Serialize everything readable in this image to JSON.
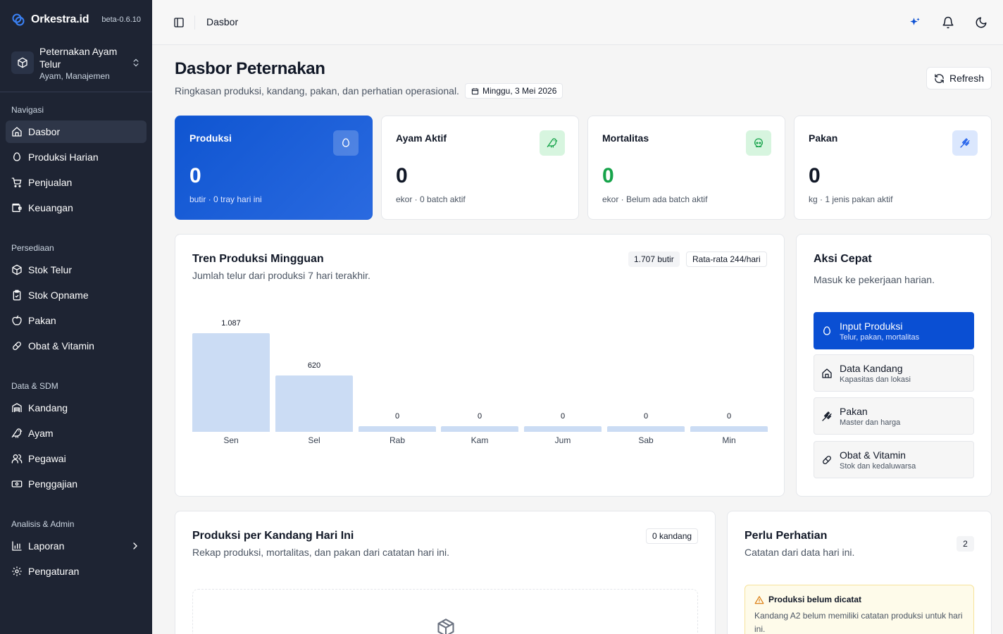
{
  "brand": {
    "name": "Orkestra.id",
    "version": "beta-0.6.10"
  },
  "org": {
    "name": "Peternakan Ayam Telur",
    "meta": "Ayam, Manajemen"
  },
  "sidebar": {
    "groups": [
      {
        "label": "Navigasi",
        "items": [
          "Dasbor",
          "Produksi Harian",
          "Penjualan",
          "Keuangan"
        ]
      },
      {
        "label": "Persediaan",
        "items": [
          "Stok Telur",
          "Stok Opname",
          "Pakan",
          "Obat & Vitamin"
        ]
      },
      {
        "label": "Data & SDM",
        "items": [
          "Kandang",
          "Ayam",
          "Pegawai",
          "Penggajian"
        ]
      },
      {
        "label": "Analisis & Admin",
        "items": [
          "Laporan",
          "Pengaturan"
        ]
      }
    ]
  },
  "header": {
    "breadcrumb": "Dasbor"
  },
  "page": {
    "title": "Dasbor Peternakan",
    "subtitle": "Ringkasan produksi, kandang, pakan, dan perhatian operasional.",
    "date": "Minggu, 3 Mei 2026",
    "refresh": "Refresh"
  },
  "stats": [
    {
      "label": "Produksi",
      "value": "0",
      "sub": "butir · 0 tray hari ini"
    },
    {
      "label": "Ayam Aktif",
      "value": "0",
      "sub": "ekor · 0 batch aktif"
    },
    {
      "label": "Mortalitas",
      "value": "0",
      "sub": "ekor · Belum ada batch aktif"
    },
    {
      "label": "Pakan",
      "value": "0",
      "sub": "kg · 1 jenis pakan aktif"
    }
  ],
  "trend": {
    "title": "Tren Produksi Mingguan",
    "subtitle": "Jumlah telur dari produksi 7 hari terakhir.",
    "total": "1.707 butir",
    "average": "Rata-rata 244/hari"
  },
  "chart_data": {
    "type": "bar",
    "categories": [
      "Sen",
      "Sel",
      "Rab",
      "Kam",
      "Jum",
      "Sab",
      "Min"
    ],
    "values": [
      1087,
      620,
      0,
      0,
      0,
      0,
      0
    ],
    "value_labels": [
      "1.087",
      "620",
      "0",
      "0",
      "0",
      "0",
      "0"
    ],
    "title": "Tren Produksi Mingguan",
    "xlabel": "",
    "ylabel": "",
    "ylim": [
      0,
      1087
    ],
    "grid": false,
    "color": "#cbdcf4"
  },
  "quick": {
    "title": "Aksi Cepat",
    "subtitle": "Masuk ke pekerjaan harian.",
    "items": [
      {
        "title": "Input Produksi",
        "sub": "Telur, pakan, mortalitas"
      },
      {
        "title": "Data Kandang",
        "sub": "Kapasitas dan lokasi"
      },
      {
        "title": "Pakan",
        "sub": "Master dan harga"
      },
      {
        "title": "Obat & Vitamin",
        "sub": "Stok dan kedaluwarsa"
      }
    ]
  },
  "per_kandang": {
    "title": "Produksi per Kandang Hari Ini",
    "subtitle": "Rekap produksi, mortalitas, dan pakan dari catatan hari ini.",
    "badge": "0 kandang"
  },
  "attention": {
    "title": "Perlu Perhatian",
    "subtitle": "Catatan dari data hari ini.",
    "count": "2",
    "alert_title": "Produksi belum dicatat",
    "alert_body": "Kandang A2 belum memiliki catatan produksi untuk hari ini."
  },
  "colors": {
    "sidebar": "#1e2433",
    "primary": "#0a4fd3",
    "bar": "#cbdcf4"
  }
}
